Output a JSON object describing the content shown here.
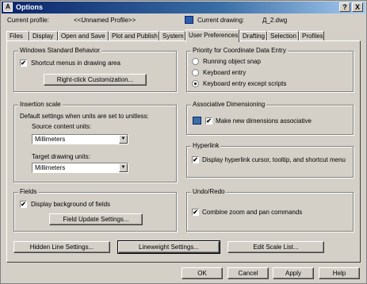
{
  "window": {
    "title": "Options",
    "help_glyph": "?",
    "close_glyph": "X"
  },
  "header": {
    "profile_label": "Current profile:",
    "profile_value": "<<Unnamed Profile>>",
    "drawing_label": "Current drawing:",
    "drawing_value": "Д_2.dwg"
  },
  "tabs": [
    {
      "label": "Files"
    },
    {
      "label": "Display"
    },
    {
      "label": "Open and Save"
    },
    {
      "label": "Plot and Publish"
    },
    {
      "label": "System"
    },
    {
      "label": "User Preferences",
      "active": true
    },
    {
      "label": "Drafting"
    },
    {
      "label": "Selection"
    },
    {
      "label": "Profiles"
    }
  ],
  "windows_behavior": {
    "title": "Windows Standard Behavior",
    "shortcut_menus": {
      "label": "Shortcut menus in drawing area",
      "checked": true
    },
    "right_click_button": "Right-click Customization..."
  },
  "insertion_scale": {
    "title": "Insertion scale",
    "description": "Default settings when units are set to unitless:",
    "source_label": "Source content units:",
    "source_value": "Millimeters",
    "target_label": "Target drawing units:",
    "target_value": "Millimeters"
  },
  "fields": {
    "title": "Fields",
    "display_background": {
      "label": "Display background of fields",
      "checked": true
    },
    "update_button": "Field Update Settings..."
  },
  "priority": {
    "title": "Priority for Coordinate Data Entry",
    "options": [
      {
        "label": "Running object snap",
        "selected": false
      },
      {
        "label": "Keyboard entry",
        "selected": false
      },
      {
        "label": "Keyboard entry except scripts",
        "selected": true
      }
    ]
  },
  "assoc_dim": {
    "title": "Associative Dimensioning",
    "make_assoc": {
      "label": "Make new dimensions associative",
      "checked": true
    }
  },
  "hyperlink": {
    "title": "Hyperlink",
    "display": {
      "label": "Display hyperlink cursor, tooltip, and shortcut menu",
      "checked": true
    }
  },
  "undo_redo": {
    "title": "Undo/Redo",
    "combine": {
      "label": "Combine zoom and pan commands",
      "checked": true
    }
  },
  "bottom_buttons": {
    "hidden_line": "Hidden Line Settings...",
    "lineweight": "Lineweight Settings...",
    "edit_scale": "Edit Scale List..."
  },
  "footer": {
    "ok": "OK",
    "cancel": "Cancel",
    "apply": "Apply",
    "help": "Help"
  },
  "check_glyph": "✔",
  "combo_arrow": "▼"
}
